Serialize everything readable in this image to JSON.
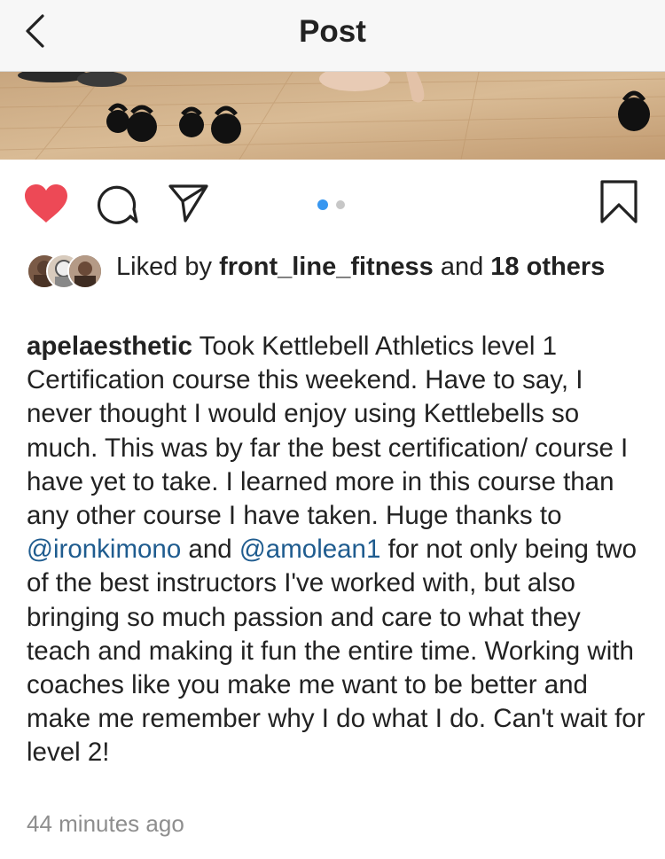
{
  "header": {
    "title": "Post"
  },
  "likes": {
    "prefix": "Liked by ",
    "user": "front_line_fitness",
    "middle": " and ",
    "count": "18",
    "suffix": "others"
  },
  "carousel": {
    "count": 2,
    "active": 0
  },
  "caption": {
    "username": "apelaesthetic",
    "text_1": " Took Kettlebell Athletics level 1 Certification course this weekend. Have to say, I never thought I would enjoy using Kettlebells so much. This was by far the best certification/ course I have yet to take. I learned more in this course than any other course I have taken. Huge thanks to ",
    "mention_1": "@ironkimono",
    "text_2": " and ",
    "mention_2": "@amolean1",
    "text_3": " for not only being two of the best instructors I've worked with, but also bringing so much passion and care to what they teach and making it fun the entire time. Working with coaches like you make me want to be better and make me remember why I do what I do. Can't wait for level 2!"
  },
  "timestamp": "44 minutes ago",
  "colors": {
    "heart": "#ed4956",
    "mention": "#1f5c8f",
    "dot_active": "#3897f0",
    "dot_inactive": "#c7c7c7",
    "muted": "#8e8e8e"
  },
  "icons": {
    "back": "chevron-left-icon",
    "like": "heart-filled-icon",
    "comment": "comment-bubble-icon",
    "share": "send-paper-plane-icon",
    "save": "bookmark-icon"
  }
}
